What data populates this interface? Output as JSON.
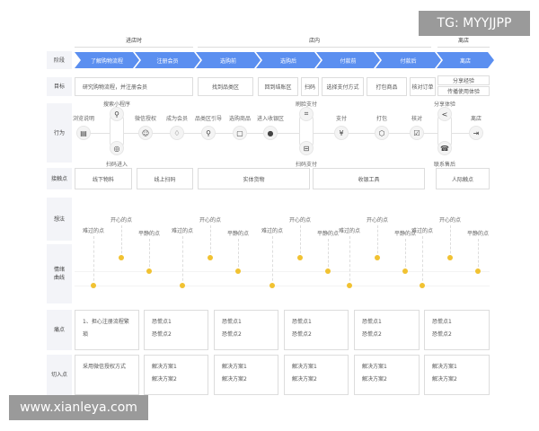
{
  "phases": [
    "进店时",
    "店内",
    "离店"
  ],
  "row_labels": {
    "stage": "阶段",
    "goal": "目标",
    "behavior": "行为",
    "touchpoint": "接触点",
    "thought": "想法",
    "emotion": "情绪曲线",
    "pain": "痛点",
    "entry": "切入点"
  },
  "stages": [
    "了解购物流程",
    "注册会员",
    "选购前",
    "选购后",
    "付款前",
    "付款后",
    "离店"
  ],
  "goals": [
    "研究购物流程，并注册会员",
    "找到品类区",
    "回到结账区",
    "扫码",
    "选择支付方式",
    "打包商品",
    "核对订单",
    "分享经验",
    "传播使用体验"
  ],
  "behaviors": [
    {
      "label": "浏览说明",
      "icon": "document-icon"
    },
    {
      "label": "搜索小程序",
      "icon": "search-icon"
    },
    {
      "label": "扫码进入",
      "icon": "compass-icon"
    },
    {
      "label": "微信授权",
      "icon": "user-icon"
    },
    {
      "label": "成为会员",
      "icon": "diamond-icon"
    },
    {
      "label": "品类区引导",
      "icon": "pin-icon"
    },
    {
      "label": "选购商品",
      "icon": "cart-icon"
    },
    {
      "label": "进入收银区",
      "icon": "money-bag-icon"
    },
    {
      "label": "刷脸支付",
      "icon": "face-scan-icon"
    },
    {
      "label": "扫码支付",
      "icon": "scan-icon"
    },
    {
      "label": "支付",
      "icon": "yuan-icon"
    },
    {
      "label": "打包",
      "icon": "package-icon"
    },
    {
      "label": "核对",
      "icon": "checklist-icon"
    },
    {
      "label": "分享体验",
      "icon": "share-icon"
    },
    {
      "label": "联系售后",
      "icon": "support-icon"
    },
    {
      "label": "离店",
      "icon": "exit-icon"
    }
  ],
  "touchpoints": [
    "线下物料",
    "线上扫码",
    "实体货物",
    "收银工具",
    "人际触点"
  ],
  "emotions": {
    "happy": "开心的点",
    "calm": "平静的点",
    "sad": "难过的点"
  },
  "emotion_sequence": [
    "sad",
    "happy",
    "calm",
    "sad",
    "happy",
    "calm",
    "sad",
    "happy",
    "calm",
    "sad",
    "happy",
    "calm",
    "sad",
    "happy",
    "calm"
  ],
  "emotion_color": "#f1c232",
  "stage_color": "#5b8ff0",
  "pain_points": [
    [
      "1、担心注册流程繁琐"
    ],
    [
      "恐慌点1",
      "恐慌点2"
    ],
    [
      "恐慌点1",
      "恐慌点2"
    ],
    [
      "恐慌点1",
      "恐慌点2"
    ],
    [
      "恐慌点1",
      "恐慌点2"
    ],
    [
      "恐慌点1",
      "恐慌点2"
    ]
  ],
  "entry_points": [
    [
      "采用微信授权方式"
    ],
    [
      "解决方案1",
      "解决方案2"
    ],
    [
      "解决方案1",
      "解决方案2"
    ],
    [
      "解决方案1",
      "解决方案2"
    ],
    [
      "解决方案1",
      "解决方案2"
    ],
    [
      "解决方案1",
      "解决方案2"
    ]
  ],
  "watermarks": {
    "top": "TG: MYYJJPP",
    "bottom": "www.xianleya.com"
  }
}
